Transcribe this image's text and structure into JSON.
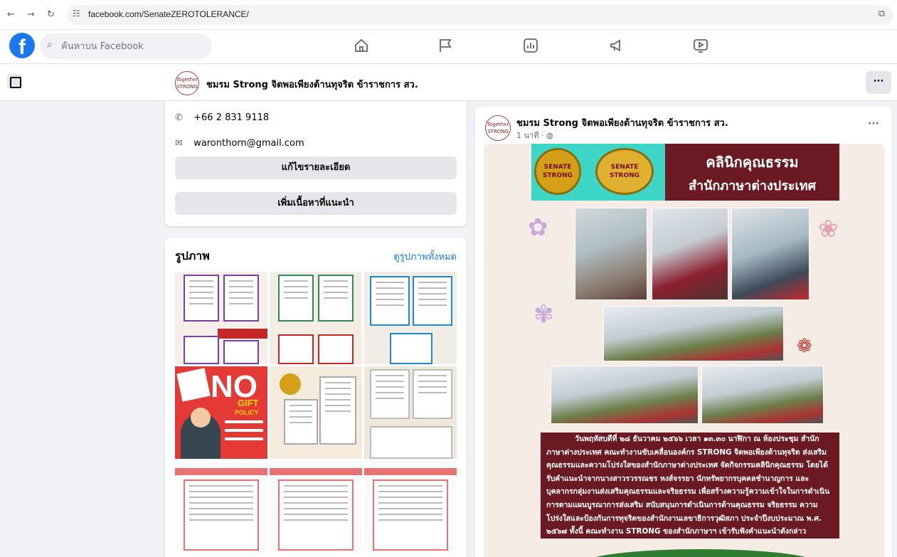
{
  "browser": {
    "url": "facebook.com/SenateZEROTOLERANCE/"
  },
  "header": {
    "search_placeholder": "ค้นหาบน Facebook"
  },
  "page": {
    "name": "ชมรม Strong จิตพอเพียงต้านทุจริต ข้าราชการ สว.",
    "logo_text": "Together STRONG"
  },
  "intro": {
    "phone": "+66 2 831 9118",
    "email": "waronthorn@gmail.com",
    "edit_details_label": "แก้ไขรายละเอียด",
    "add_featured_label": "เพิ่มเนื้อหาที่แนะนำ"
  },
  "photos": {
    "title": "รูปภาพ",
    "see_all_label": "ดูรูปภาพทั้งหมด",
    "no_gift": {
      "big": "NO",
      "gift": "GIFT",
      "policy": "POLICY"
    }
  },
  "post": {
    "author": "ชมรม Strong จิตพอเพียงต้านทุจริต ข้าราชการ สว.",
    "time": "1 นาที ·",
    "poster": {
      "seal1": "SENATE STRONG",
      "seal2": "SENATE STRONG",
      "title_line1": "คลินิกคุณธรรม",
      "title_line2": "สำนักภาษาต่างประเทศ",
      "body": "วันพฤหัสบดีที่ ๒๘ ธันวาคม ๒๕๖๖ เวลา ๑๓.๓๐ นาฬิกา ณ ห้องประชุม สำนักภาษาต่างประเทศ คณะทำงานขับเคลื่อนองค์กร STRONG จิตพอเพียงต้านทุจริต ส่งเสริมคุณธรรมและความโปร่งใสของสำนักภาษาต่างประเทศ จัดกิจกรรมคลินิกคุณธรรม โดยได้รับคำแนะนำจากนางสาวรวรรณชร หงส์จรรยา นักทรัพยากรบุคคลชำนาญการ และบุคลากรกลุ่มงานส่งเสริมคุณธรรมและจริยธรรม เพื่อสร้างความรู้ความเข้าใจในการดำเนินการตามแผนบูรณาการส่งเสริม สนับสนุนการดำเนินการด้านคุณธรรม จริยธรรม ความโปร่งใสและป้องกันการทุจริตของสำนักงานเลขาธิการวุฒิสภา ประจำปีงบประมาณ พ.ศ. ๒๕๖๗ ทั้งนี้ คณะทำงาน STRONG ของสำนักภาษาฯ เข้ารับฟังคำแนะนำดังกล่าว"
    }
  },
  "colors": {
    "fb_blue": "#1877f2",
    "poster_maroon": "#6b1a24",
    "poster_teal": "#3dd6c6"
  }
}
